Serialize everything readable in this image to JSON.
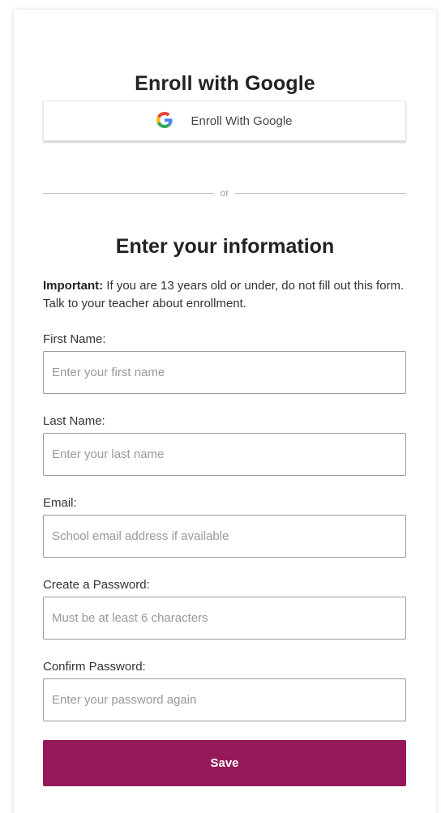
{
  "google_section": {
    "heading": "Enroll with Google",
    "button_label": "Enroll With Google",
    "icon": "google-g-icon"
  },
  "divider": {
    "text": "or"
  },
  "form": {
    "heading": "Enter your information",
    "notice_bold": "Important:",
    "notice_text": " If you are 13 years old or under, do not fill out this form. Talk to your teacher about enrollment.",
    "fields": [
      {
        "label": "First Name:",
        "placeholder": "Enter your first name",
        "value": ""
      },
      {
        "label": "Last Name:",
        "placeholder": "Enter your last name",
        "value": ""
      },
      {
        "label": "Email:",
        "placeholder": "School email address if available",
        "value": ""
      },
      {
        "label": "Create a Password:",
        "placeholder": "Must be at least 6 characters",
        "value": ""
      },
      {
        "label": "Confirm Password:",
        "placeholder": "Enter your password again",
        "value": ""
      }
    ],
    "save_label": "Save"
  },
  "colors": {
    "save_button": "#951958",
    "google_blue": "#4285F4",
    "google_red": "#EA4335",
    "google_yellow": "#FBBC05",
    "google_green": "#34A853"
  }
}
